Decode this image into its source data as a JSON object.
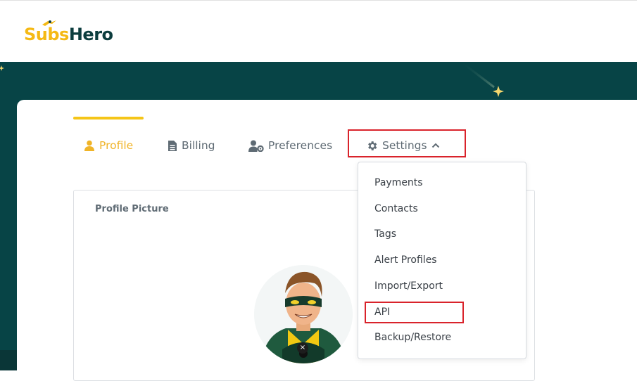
{
  "header": {
    "logo_part1": "Subs",
    "logo_part2": "Hero",
    "colors": {
      "brand_yellow": "#f5b914",
      "brand_dark": "#0c3d3e",
      "banner_bg": "#074446",
      "highlight_red": "#d9232b"
    }
  },
  "tabs": [
    {
      "label": "Profile",
      "icon": "user-icon",
      "active": true
    },
    {
      "label": "Billing",
      "icon": "document-icon",
      "active": false
    },
    {
      "label": "Preferences",
      "icon": "user-cog-icon",
      "active": false
    },
    {
      "label": "Settings",
      "icon": "gear-icon",
      "active": false,
      "expanded": true
    }
  ],
  "profile": {
    "section_title": "Profile Picture",
    "remove_symbol": "×"
  },
  "settings_menu": {
    "items": [
      "Payments",
      "Contacts",
      "Tags",
      "Alert Profiles",
      "Import/Export",
      "API",
      "Backup/Restore"
    ],
    "highlighted": "API"
  }
}
